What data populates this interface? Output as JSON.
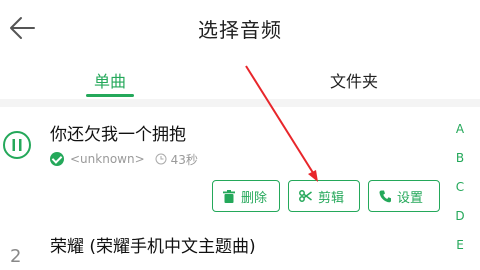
{
  "header": {
    "title": "选择音频",
    "back_icon": "back-arrow-icon"
  },
  "tabs": [
    {
      "label": "单曲",
      "active": true
    },
    {
      "label": "文件夹",
      "active": false
    }
  ],
  "songs": [
    {
      "index": "",
      "title": "你还欠我一个拥抱",
      "artist": "<unknown>",
      "duration": "43秒",
      "actions": [
        {
          "label": "删除",
          "icon": "trash-icon"
        },
        {
          "label": "剪辑",
          "icon": "scissors-icon"
        },
        {
          "label": "设置",
          "icon": "phone-icon"
        }
      ]
    },
    {
      "index": "2",
      "title": "荣耀 (荣耀手机中文主题曲)",
      "artist": "",
      "duration": ""
    }
  ],
  "index_letters": [
    "A",
    "B",
    "C",
    "D",
    "E"
  ],
  "colors": {
    "accent": "#24a85a",
    "annotation_arrow": "#e8262b"
  }
}
